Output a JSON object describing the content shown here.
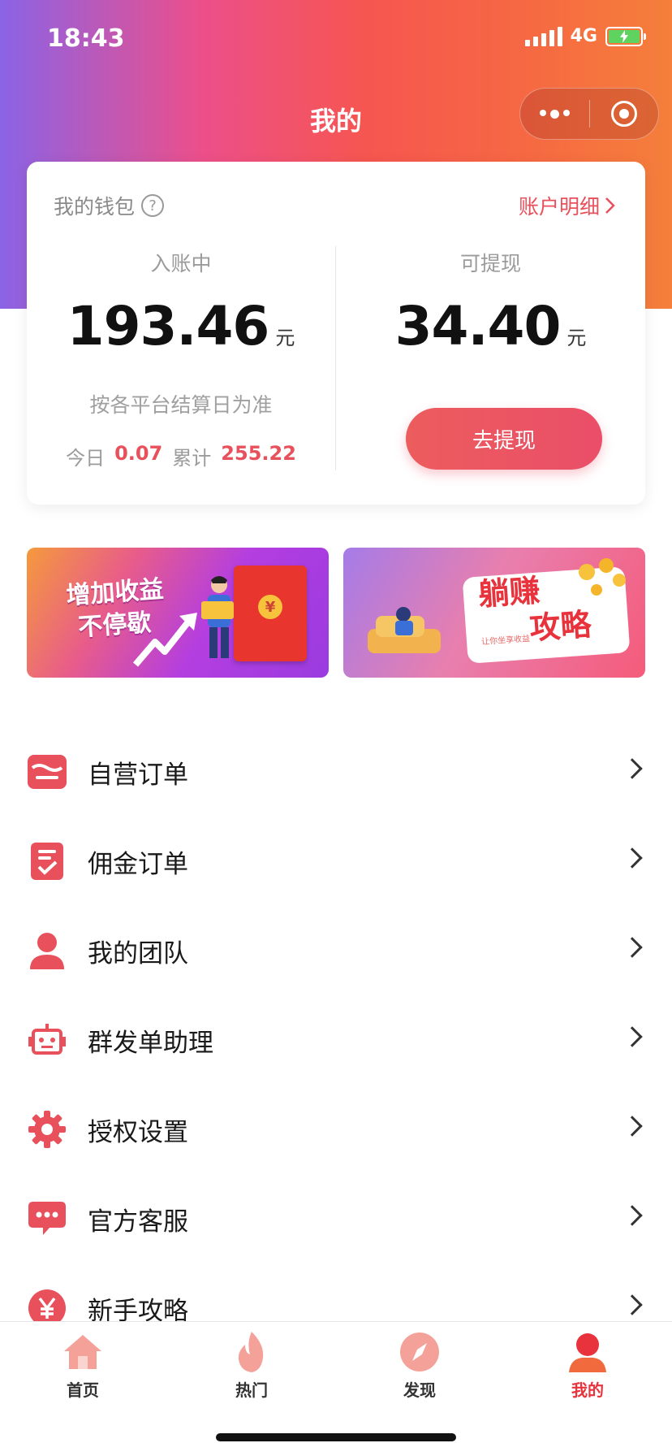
{
  "status_bar": {
    "time": "18:43",
    "network": "4G"
  },
  "nav": {
    "title": "我的"
  },
  "wallet": {
    "title": "我的钱包",
    "detail_link": "账户明细",
    "pending": {
      "label": "入账中",
      "amount": "193.46",
      "unit": "元",
      "note": "按各平台结算日为准"
    },
    "today": {
      "label": "今日",
      "value": "0.07"
    },
    "total": {
      "label": "累计",
      "value": "255.22"
    },
    "withdrawable": {
      "label": "可提现",
      "amount": "34.40",
      "unit": "元",
      "button": "去提现"
    }
  },
  "banners": {
    "left": {
      "line1": "增加收益",
      "line2": "不停歇"
    },
    "right": {
      "line1": "躺赚",
      "line2": "攻略",
      "sub": "让你坐享收益"
    }
  },
  "menu": [
    {
      "label": "自营订单",
      "icon": "store-icon"
    },
    {
      "label": "佣金订单",
      "icon": "checklist-icon"
    },
    {
      "label": "我的团队",
      "icon": "user-icon"
    },
    {
      "label": "群发单助理",
      "icon": "robot-icon"
    },
    {
      "label": "授权设置",
      "icon": "gear-icon"
    },
    {
      "label": "官方客服",
      "icon": "chat-icon"
    },
    {
      "label": "新手攻略",
      "icon": "yen-icon"
    }
  ],
  "tabs": [
    {
      "label": "首页",
      "icon": "home-icon",
      "active": false
    },
    {
      "label": "热门",
      "icon": "flame-icon",
      "active": false
    },
    {
      "label": "发现",
      "icon": "compass-icon",
      "active": false
    },
    {
      "label": "我的",
      "icon": "profile-icon",
      "active": true
    }
  ],
  "colors": {
    "accent": "#e8505b",
    "hero_start": "#8b63e6",
    "hero_end": "#f57f3b"
  }
}
